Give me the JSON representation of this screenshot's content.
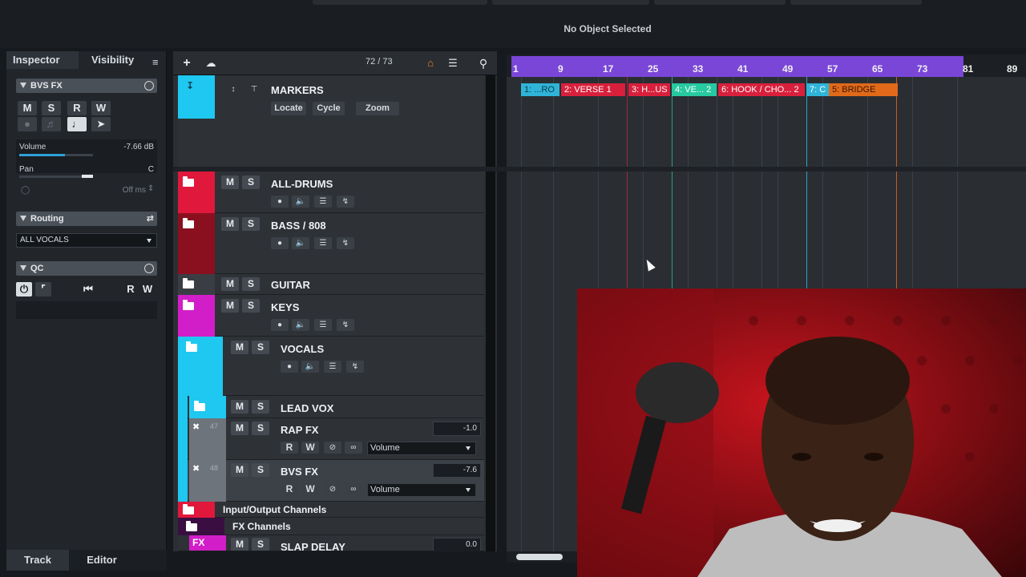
{
  "status": {
    "no_object": "No Object Selected"
  },
  "inspector": {
    "tabs": [
      "Inspector",
      "Visibility"
    ],
    "track_name": "BVS FX",
    "buttons": [
      "M",
      "S",
      "R",
      "W"
    ],
    "volume_label": "Volume",
    "volume_value": "-7.66 dB",
    "volume_level": 0.62,
    "pan_label": "Pan",
    "pan_value": "C",
    "delay_value": "Off ms",
    "routing_label": "Routing",
    "routing_value": "ALL VOCALS",
    "qc_label": "QC",
    "qc_rw": [
      "R",
      "W"
    ]
  },
  "bottom_tabs": [
    "Track",
    "Editor"
  ],
  "toolbar": {
    "add": "+",
    "counter": "72 / 73"
  },
  "tracks": {
    "markers": {
      "name": "MARKERS",
      "locate": "Locate",
      "cycle": "Cycle",
      "zoom": "Zoom"
    },
    "all_drums": "ALL-DRUMS",
    "bass": "BASS / 808",
    "guitar": "GUITAR",
    "keys": "KEYS",
    "vocals": "VOCALS",
    "lead_vox": "LEAD VOX",
    "rap_fx": {
      "name": "RAP FX",
      "num": "47",
      "value": "-1.0",
      "param": "Volume"
    },
    "bvs_fx": {
      "name": "BVS FX",
      "num": "48",
      "value": "-7.6",
      "param": "Volume"
    },
    "io": "Input/Output Channels",
    "fx_channels": "FX Channels",
    "slap": {
      "name": "SLAP DELAY",
      "badge": "FX",
      "value": "0.0"
    }
  },
  "ms": {
    "m": "M",
    "s": "S",
    "r": "R",
    "w": "W"
  },
  "ruler": [
    "1",
    "9",
    "17",
    "25",
    "33",
    "41",
    "49",
    "57",
    "65",
    "73",
    "81",
    "89"
  ],
  "markers": [
    {
      "label": "1: ...RO",
      "color": "#2fb4d8"
    },
    {
      "label": "2: VERSE 1",
      "color": "#d8203c"
    },
    {
      "label": "3: H...US",
      "color": "#d8203c"
    },
    {
      "label": "4: VE... 2",
      "color": "#27c9a0"
    },
    {
      "label": "6: HOOK / CHO... 2",
      "color": "#d8203c"
    },
    {
      "label": "7: C",
      "color": "#2fb4d8"
    },
    {
      "label": "5: BRIDGE",
      "color": "#e06a1a"
    }
  ],
  "colors": {
    "cyan": "#1ec8f0",
    "red": "#e0183c",
    "maroon": "#8a1020",
    "magenta": "#d21ec8",
    "cycle": "#7a46d8"
  }
}
